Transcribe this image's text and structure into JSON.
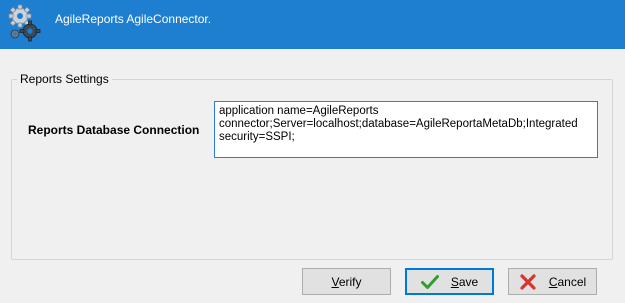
{
  "window": {
    "title": "AgileReports AgileConnector.",
    "titlebar_color": "#1e7ed0",
    "app_icon": "gears-icon"
  },
  "group": {
    "legend": "Reports Settings"
  },
  "connection": {
    "label": "Reports Database Connection",
    "value": "application name=AgileReports connector;Server=localhost;database=AgileReportaMetaDb;Integrated security=SSPI;"
  },
  "buttons": {
    "verify_label": "Verify",
    "save_label": "Save",
    "save_icon": "checkmark-icon",
    "cancel_label": "Cancel",
    "cancel_icon": "cancel-x-icon"
  },
  "colors": {
    "accent": "#0078d7",
    "check_green": "#2e9e2e",
    "cancel_red": "#d9342b"
  }
}
